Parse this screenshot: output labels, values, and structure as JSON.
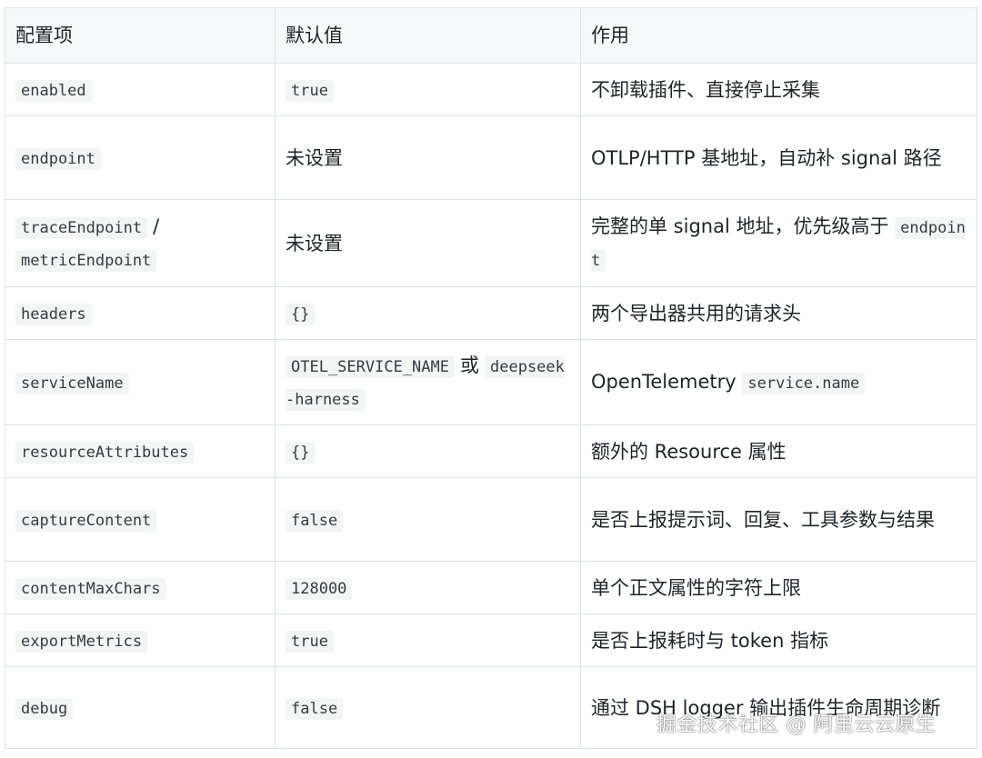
{
  "table": {
    "headers": [
      "配置项",
      "默认值",
      "作用"
    ],
    "rows": [
      {
        "key": "enabled",
        "default_code": "true",
        "desc": "不卸载插件、直接停止采集"
      },
      {
        "key": "endpoint",
        "default_text": "未设置",
        "desc": "OTLP/HTTP 基地址，自动补 signal 路径"
      },
      {
        "key_a": "traceEndpoint",
        "key_sep": "/",
        "key_b": "metricEndpoint",
        "default_text": "未设置",
        "desc": "完整的单 signal 地址，优先级高于",
        "desc_code": "endpoint"
      },
      {
        "key": "headers",
        "default_code": "{}",
        "desc": "两个导出器共用的请求头"
      },
      {
        "key": "serviceName",
        "default_code_a": "OTEL_SERVICE_NAME",
        "default_sep": "或",
        "default_code_b": "deepseek-harness",
        "desc": "OpenTelemetry",
        "desc_code": "service.name"
      },
      {
        "key": "resourceAttributes",
        "default_code": "{}",
        "desc": "额外的 Resource 属性"
      },
      {
        "key": "captureContent",
        "default_code": "false",
        "desc": "是否上报提示词、回复、工具参数与结果"
      },
      {
        "key": "contentMaxChars",
        "default_code": "128000",
        "desc": "单个正文属性的字符上限"
      },
      {
        "key": "exportMetrics",
        "default_code": "true",
        "desc": "是否上报耗时与 token 指标"
      },
      {
        "key": "debug",
        "default_code": "false",
        "desc": "通过 DSH logger 输出插件生命周期诊断"
      }
    ]
  },
  "watermark": "掘金技术社区 @ 阿里云云原生"
}
